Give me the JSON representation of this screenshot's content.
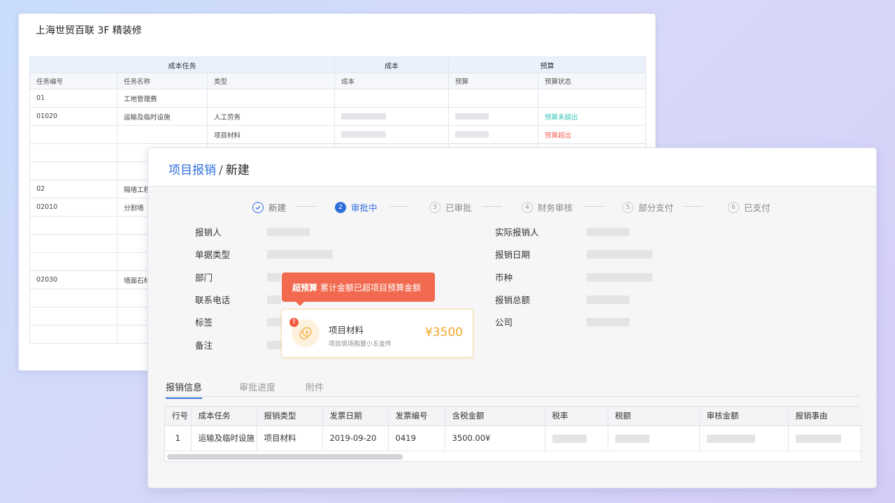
{
  "back": {
    "title": "上海世贸百联 3F 精装修",
    "group_headers": [
      "成本任务",
      "成本",
      "预算"
    ],
    "sub_headers": [
      "任务编号",
      "任务名称",
      "类型",
      "成本",
      "预算",
      "预算状态"
    ],
    "rows": [
      {
        "code": "01",
        "name": "工地管理费",
        "type": "",
        "status": ""
      },
      {
        "code": "01020",
        "name": "运输及临时设施",
        "type": "人工劳务",
        "status": "预算未超出"
      },
      {
        "code": "",
        "name": "",
        "type": "项目材料",
        "status": "预算超出"
      },
      {
        "code": "",
        "name": "",
        "type": "",
        "status": ""
      },
      {
        "code": "",
        "name": "",
        "type": "",
        "status": ""
      },
      {
        "code": "02",
        "name": "隔墙工程",
        "type": "",
        "status": ""
      },
      {
        "code": "02010",
        "name": "分割墙",
        "type": "",
        "status": ""
      },
      {
        "code": "",
        "name": "",
        "type": "",
        "status": ""
      },
      {
        "code": "",
        "name": "",
        "type": "",
        "status": ""
      },
      {
        "code": "",
        "name": "",
        "type": "",
        "status": ""
      },
      {
        "code": "02030",
        "name": "墙面石材",
        "type": "",
        "status": ""
      },
      {
        "code": "",
        "name": "",
        "type": "",
        "status": ""
      },
      {
        "code": "",
        "name": "",
        "type": "",
        "status": ""
      },
      {
        "code": "",
        "name": "",
        "type": "",
        "status": ""
      }
    ],
    "status_colors": {
      "ok": "#36c7b8",
      "over": "#f2665a"
    }
  },
  "front": {
    "breadcrumb_link": "项目报销",
    "breadcrumb_sep": "/",
    "breadcrumb_current": "新建",
    "steps": [
      {
        "num": "✓",
        "label": "新建",
        "state": "done"
      },
      {
        "num": "2",
        "label": "审批中",
        "state": "active"
      },
      {
        "num": "3",
        "label": "已审批",
        "state": "todo"
      },
      {
        "num": "4",
        "label": "财务审核",
        "state": "todo"
      },
      {
        "num": "5",
        "label": "部分支付",
        "state": "todo"
      },
      {
        "num": "6",
        "label": "已支付",
        "state": "todo"
      }
    ],
    "form_left": [
      "报销人",
      "单据类型",
      "部门",
      "联系电话",
      "标签",
      "备注"
    ],
    "form_right": [
      "实际报销人",
      "报销日期",
      "币种",
      "报销总额",
      "公司"
    ],
    "tooltip_bold": "超预算",
    "tooltip_text": "累计金额已超项目预算金额",
    "item_name": "项目材料",
    "item_desc": "项目现场购置小五金件",
    "item_amount": "¥3500",
    "tabs": [
      "报销信息",
      "审批进度",
      "附件"
    ],
    "table_headers": [
      "行号",
      "成本任务",
      "报销类型",
      "发票日期",
      "发票编号",
      "含税金额",
      "税率",
      "税额",
      "审核金额",
      "报销事由"
    ],
    "table_row": {
      "line": "1",
      "task": "运输及临时设施",
      "type": "项目材料",
      "date": "2019-09-20",
      "invoice": "0419",
      "amount": "3500.00¥"
    },
    "accent": "#2f6fdc",
    "warning": "#f16a4f",
    "amount_color": "#f2a628"
  }
}
